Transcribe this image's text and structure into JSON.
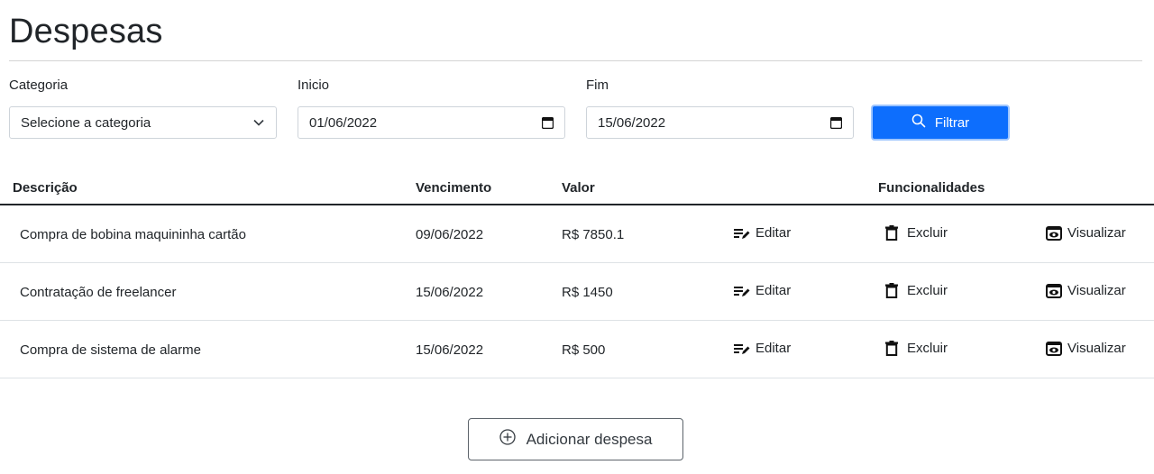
{
  "header": {
    "title": "Despesas"
  },
  "filters": {
    "category": {
      "label": "Categoria",
      "value": "Selecione a categoria"
    },
    "start": {
      "label": "Inicio",
      "value": "01/06/2022"
    },
    "end": {
      "label": "Fim",
      "value": "15/06/2022"
    },
    "filter_button": "Filtrar"
  },
  "table": {
    "columns": {
      "description": "Descrição",
      "due": "Vencimento",
      "value": "Valor",
      "actions": "Funcionalidades"
    },
    "rows": [
      {
        "description": "Compra de bobina maquininha cartão",
        "due": "09/06/2022",
        "value": "R$ 7850.1",
        "edit": "Editar",
        "delete": "Excluir",
        "view": "Visualizar"
      },
      {
        "description": "Contratação de freelancer",
        "due": "15/06/2022",
        "value": "R$ 1450",
        "edit": "Editar",
        "delete": "Excluir",
        "view": "Visualizar"
      },
      {
        "description": "Compra de sistema de alarme",
        "due": "15/06/2022",
        "value": "R$ 500",
        "edit": "Editar",
        "delete": "Excluir",
        "view": "Visualizar"
      }
    ]
  },
  "add_button": "Adicionar despesa",
  "icons": {
    "select": "chevron-down-icon",
    "date": "calendar-icon",
    "filter": "search-icon",
    "edit": "edit-list-icon",
    "delete": "trash-icon",
    "view": "eye-icon",
    "add": "plus-circle-icon"
  },
  "colors": {
    "primary": "#0d6efd",
    "primary_focus": "#9ec5fe",
    "text": "#212529",
    "border": "#ced4da"
  }
}
